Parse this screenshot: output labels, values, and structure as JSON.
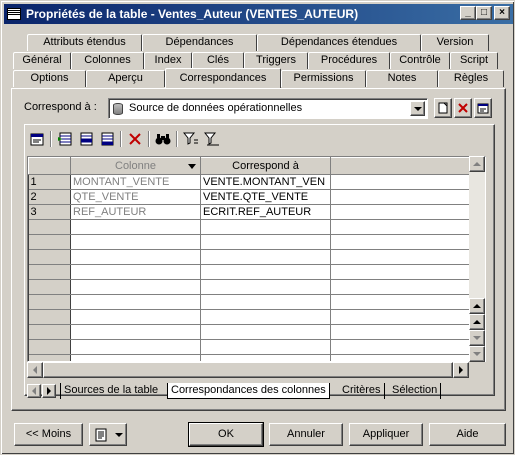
{
  "window": {
    "title": "Propriétés de la table - Ventes_Auteur (VENTES_AUTEUR)",
    "caption_buttons": [
      "_",
      "□",
      "×"
    ]
  },
  "tabs": {
    "row1": [
      "Attributs étendus",
      "Dépendances",
      "Dépendances étendues",
      "Version"
    ],
    "row2": [
      "Général",
      "Colonnes",
      "Index",
      "Clés",
      "Triggers",
      "Procédures",
      "Contrôle",
      "Script"
    ],
    "row3": [
      "Options",
      "Aperçu",
      "Correspondances",
      "Permissions",
      "Notes",
      "Règles"
    ],
    "active": "Correspondances"
  },
  "mapping": {
    "label": "Correspond à :",
    "source_value": "Source de données opérationnelles",
    "side_buttons": [
      "new-icon",
      "delete-icon",
      "properties-icon"
    ]
  },
  "toolbar": {
    "icons": [
      "properties-icon",
      "add-columns-icon",
      "insert-row-icon",
      "add-row-icon",
      "delete-icon",
      "find-icon",
      "filter-icon",
      "clear-filter-icon"
    ]
  },
  "grid": {
    "columns": [
      "Colonne",
      "Correspond à"
    ],
    "rows": [
      {
        "num": "1",
        "colonne": "MONTANT_VENTE",
        "correspond": "VENTE.MONTANT_VEN"
      },
      {
        "num": "2",
        "colonne": "QTE_VENTE",
        "correspond": "VENTE.QTE_VENTE"
      },
      {
        "num": "3",
        "colonne": "REF_AUTEUR",
        "correspond": "ECRIT.REF_AUTEUR"
      }
    ],
    "empty_rows": 10
  },
  "subtabs": {
    "items": [
      "Sources de la table",
      "Correspondances des colonnes",
      "Critères",
      "Sélection"
    ],
    "active": "Correspondances des colonnes"
  },
  "footer": {
    "less_label": "<< Moins",
    "ok_label": "OK",
    "cancel_label": "Annuler",
    "apply_label": "Appliquer",
    "help_label": "Aide"
  },
  "colors": {
    "title_start": "#0a246a",
    "title_end": "#3a6ea5",
    "face": "#d4d0c8",
    "delete_red": "#c00000"
  }
}
